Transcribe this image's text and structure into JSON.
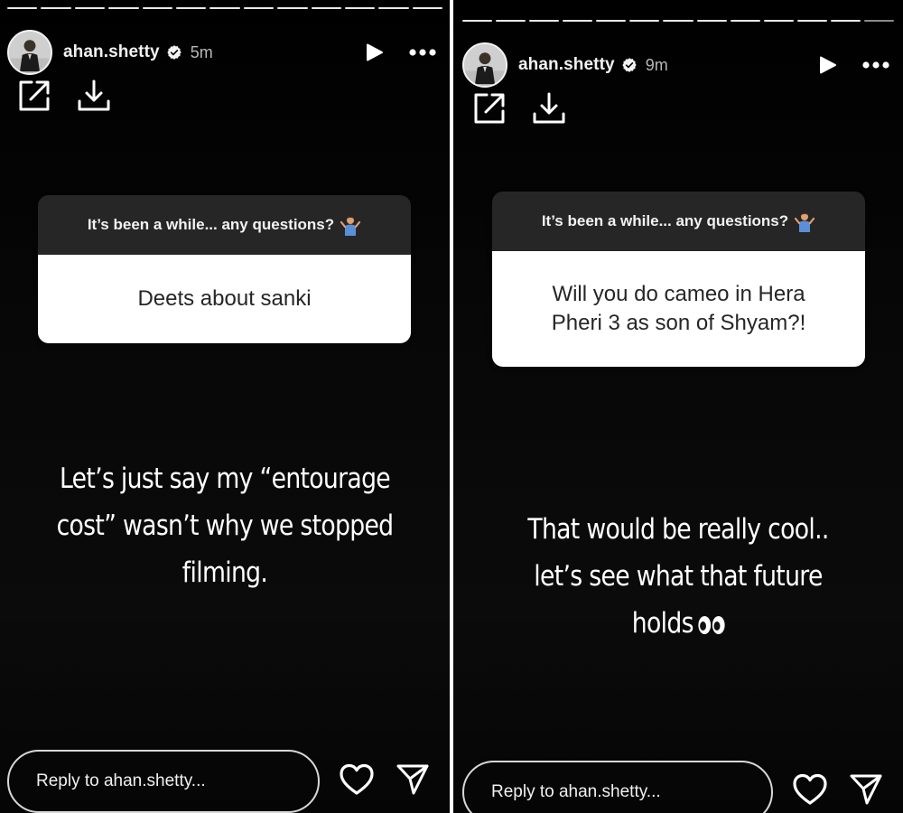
{
  "stories": [
    {
      "username": "ahan.shetty",
      "time_ago": "5m",
      "question_prompt": "It’s been a while... any questions?",
      "question_text": "Deets about sanki",
      "answer_text": "Let’s just say my “entourage cost” wasn’t why we stopped filming.",
      "reply_placeholder": "Reply to ahan.shetty...",
      "segments_total": 13,
      "segments_completed": 13
    },
    {
      "username": "ahan.shetty",
      "time_ago": "9m",
      "question_prompt": "It’s been a while... any questions?",
      "question_text": "Will you do cameo in Hera Pheri 3 as son of Shyam?!",
      "answer_text": "That would be really cool.. let’s see what that future holds",
      "reply_placeholder": "Reply to ahan.shetty...",
      "segments_total": 13,
      "segments_completed": 12
    }
  ],
  "icons": {
    "verified": "verified-badge-icon",
    "play": "play-icon",
    "more": "more-options-icon",
    "share": "share-external-icon",
    "download": "download-icon",
    "shrug": "person-shrugging-emoji-icon",
    "eyes": "eyes-emoji-icon",
    "heart": "heart-icon",
    "send": "send-icon"
  },
  "colors": {
    "background": "#000000",
    "question_header": "#262626",
    "question_body": "#ffffff",
    "text": "#ffffff"
  }
}
